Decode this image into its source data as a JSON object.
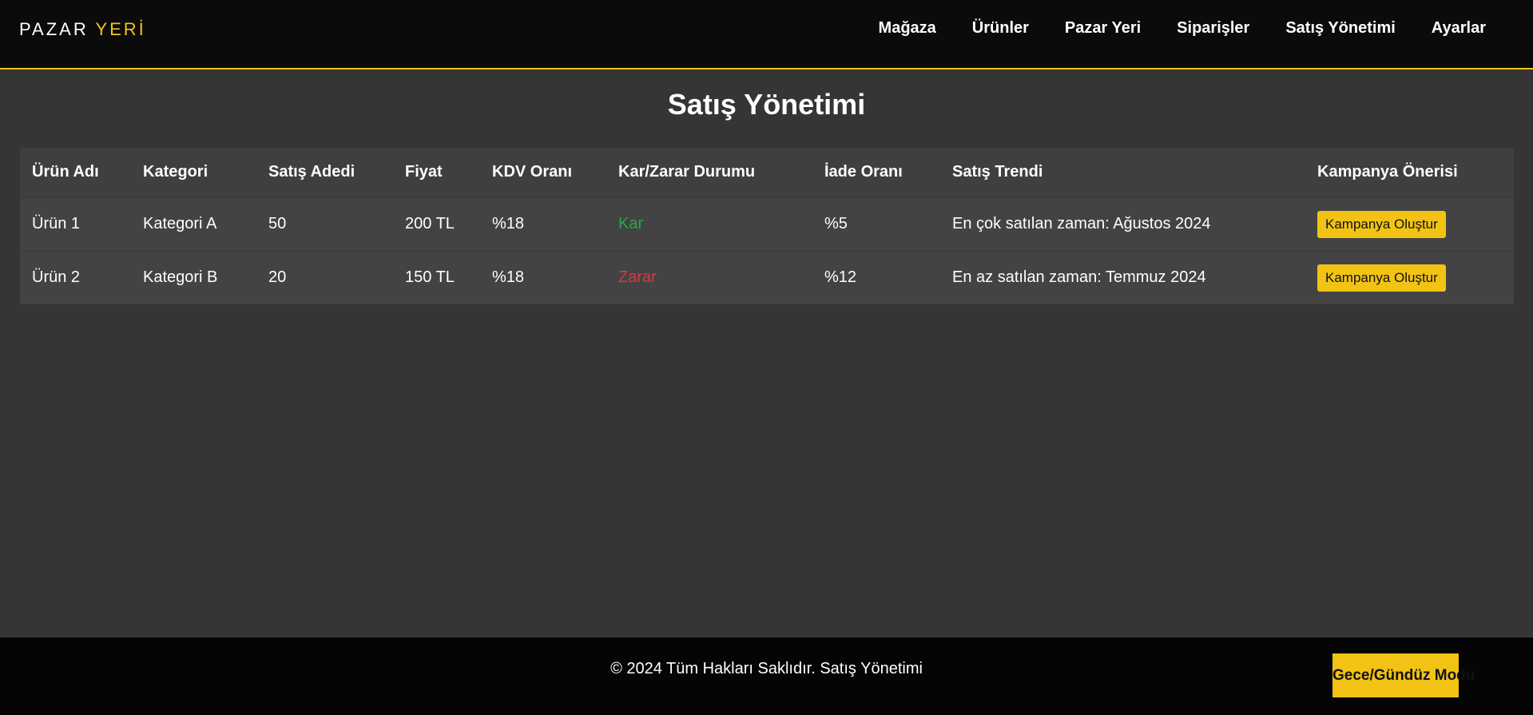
{
  "header": {
    "logo_main": "PAZAR ",
    "logo_accent": "YERİ",
    "nav": [
      "Mağaza",
      "Ürünler",
      "Pazar Yeri",
      "Siparişler",
      "Satış Yönetimi",
      "Ayarlar"
    ]
  },
  "main": {
    "title": "Satış Yönetimi",
    "table": {
      "headers": [
        "Ürün Adı",
        "Kategori",
        "Satış Adedi",
        "Fiyat",
        "KDV Oranı",
        "Kar/Zarar Durumu",
        "İade Oranı",
        "Satış Trendi",
        "Kampanya Önerisi"
      ],
      "rows": [
        {
          "name": "Ürün 1",
          "category": "Kategori A",
          "qty": "50",
          "price": "200 TL",
          "vat": "%18",
          "profit": "Kar",
          "returns": "%5",
          "trend": "En çok satılan zaman: Ağustos 2024",
          "action": "Kampanya Oluştur"
        },
        {
          "name": "Ürün 2",
          "category": "Kategori B",
          "qty": "20",
          "price": "150 TL",
          "vat": "%18",
          "profit": "Zarar",
          "returns": "%12",
          "trend": "En az satılan zaman: Temmuz 2024",
          "action": "Kampanya Oluştur"
        }
      ]
    }
  },
  "footer": {
    "text": "© 2024 Tüm Hakları Saklıdır. Satış Yönetimi",
    "mode_button": "Gece/Gündüz Modu"
  },
  "colors": {
    "accent": "#f2c314",
    "profit": "#28a745",
    "loss": "#dc3545",
    "background": "#353535",
    "header_bg": "#0b0b0b"
  }
}
